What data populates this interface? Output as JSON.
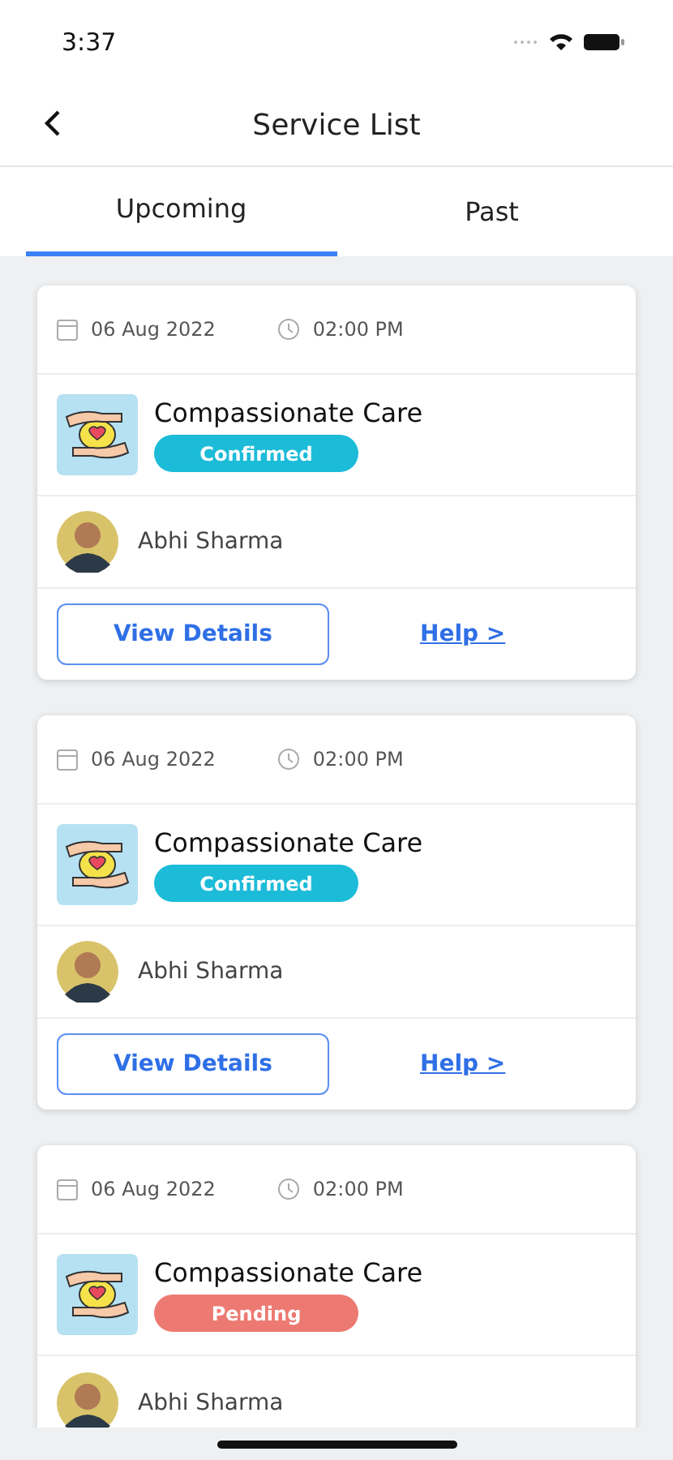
{
  "status_bar": {
    "time": "3:37"
  },
  "header": {
    "title": "Service List"
  },
  "tabs": [
    {
      "label": "Upcoming",
      "selected": true
    },
    {
      "label": "Past",
      "selected": false
    }
  ],
  "bookings": [
    {
      "date": "06 Aug 2022",
      "time": "02:00 PM",
      "service": "Compassionate Care",
      "status": "Confirmed",
      "color": "#1cbcd8",
      "person": "Abhi Sharma",
      "actions": {
        "details": "View Details",
        "help": "Help >"
      }
    },
    {
      "date": "06 Aug 2022",
      "time": "02:00 PM",
      "service": "Compassionate Care",
      "status": "Confirmed",
      "color": "#1cbcd8",
      "person": "Abhi Sharma",
      "actions": {
        "details": "View Details",
        "help": "Help >"
      }
    },
    {
      "date": "06 Aug 2022",
      "time": "02:00 PM",
      "service": "Compassionate Care",
      "status": "Pending",
      "color": "#ec7a72",
      "person": "Abhi Sharma"
    }
  ]
}
